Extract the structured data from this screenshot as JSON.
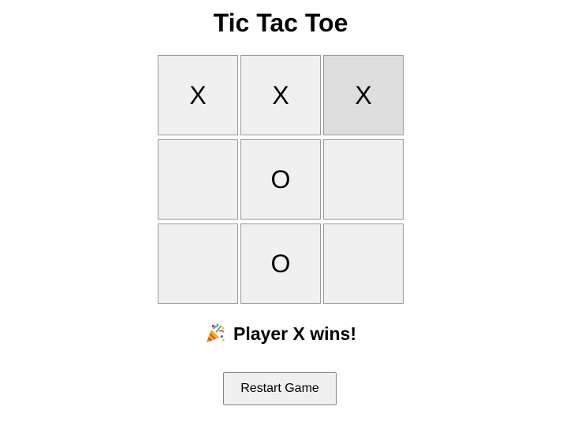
{
  "title": "Tic Tac Toe",
  "board": {
    "cells": [
      "X",
      "X",
      "X",
      "",
      "O",
      "",
      "",
      "O",
      ""
    ],
    "highlighted_cells": [
      2
    ]
  },
  "status": {
    "icon": "party-popper-icon",
    "text": "Player X wins!"
  },
  "restart_button": {
    "label": "Restart Game"
  },
  "colors": {
    "cell_background": "#f0f0f0",
    "cell_highlight": "#dddddd",
    "cell_border": "#999999"
  }
}
